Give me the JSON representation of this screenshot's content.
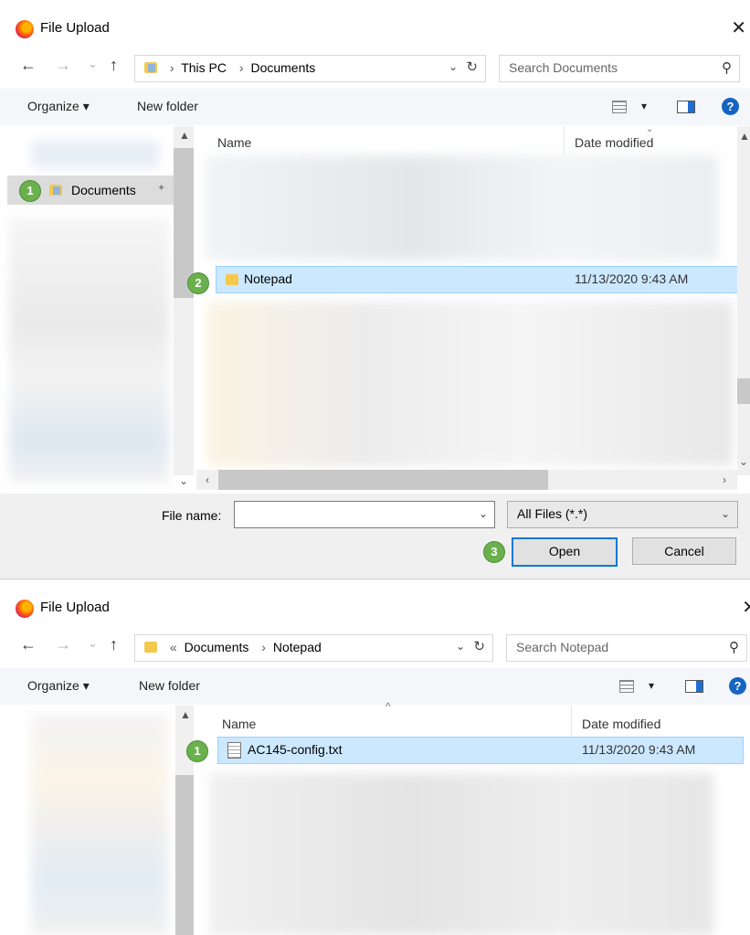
{
  "dialog1": {
    "title": "File Upload",
    "close_glyph": "✕",
    "nav": {
      "back": "←",
      "forward": "→",
      "recent": "⌄",
      "up": "↑",
      "refresh": "↻",
      "dropdown": "⌄"
    },
    "breadcrumbs": [
      "This PC",
      "Documents"
    ],
    "search_placeholder": "Search Documents",
    "toolbar": {
      "organize": "Organize ▾",
      "new_folder": "New folder",
      "view_dropdown": "▾",
      "help": "?"
    },
    "sidebar": {
      "pinned_item": "Documents",
      "pin_glyph": "📌",
      "badge": "1"
    },
    "columns": {
      "name": "Name",
      "date": "Date modified"
    },
    "selected_row": {
      "name": "Notepad",
      "date": "11/13/2020 9:43 AM",
      "badge": "2"
    },
    "file_name_label": "File name:",
    "file_name_value": "",
    "filter_value": "All Files (*.*)",
    "open_button": "Open",
    "cancel_button": "Cancel",
    "open_badge": "3"
  },
  "dialog2": {
    "title": "File Upload",
    "close_glyph": "✕",
    "nav": {
      "back": "←",
      "forward": "→",
      "recent": "⌄",
      "up": "↑",
      "refresh": "↻",
      "dropdown": "⌄"
    },
    "breadcrumb_overflow": "«",
    "breadcrumbs": [
      "Documents",
      "Notepad"
    ],
    "search_placeholder": "Search Notepad",
    "toolbar": {
      "organize": "Organize ▾",
      "new_folder": "New folder",
      "view_dropdown": "▾",
      "help": "?"
    },
    "columns": {
      "name": "Name",
      "date": "Date modified"
    },
    "selected_row": {
      "name": "AC145-config.txt",
      "date": "11/13/2020 9:43 AM",
      "badge": "1"
    }
  },
  "colors": {
    "selection": "#cce8ff",
    "selection_border": "#99d1ff",
    "badge": "#6ab04c",
    "accent": "#0078d7",
    "toolbar_bg": "#f4f6f9"
  }
}
